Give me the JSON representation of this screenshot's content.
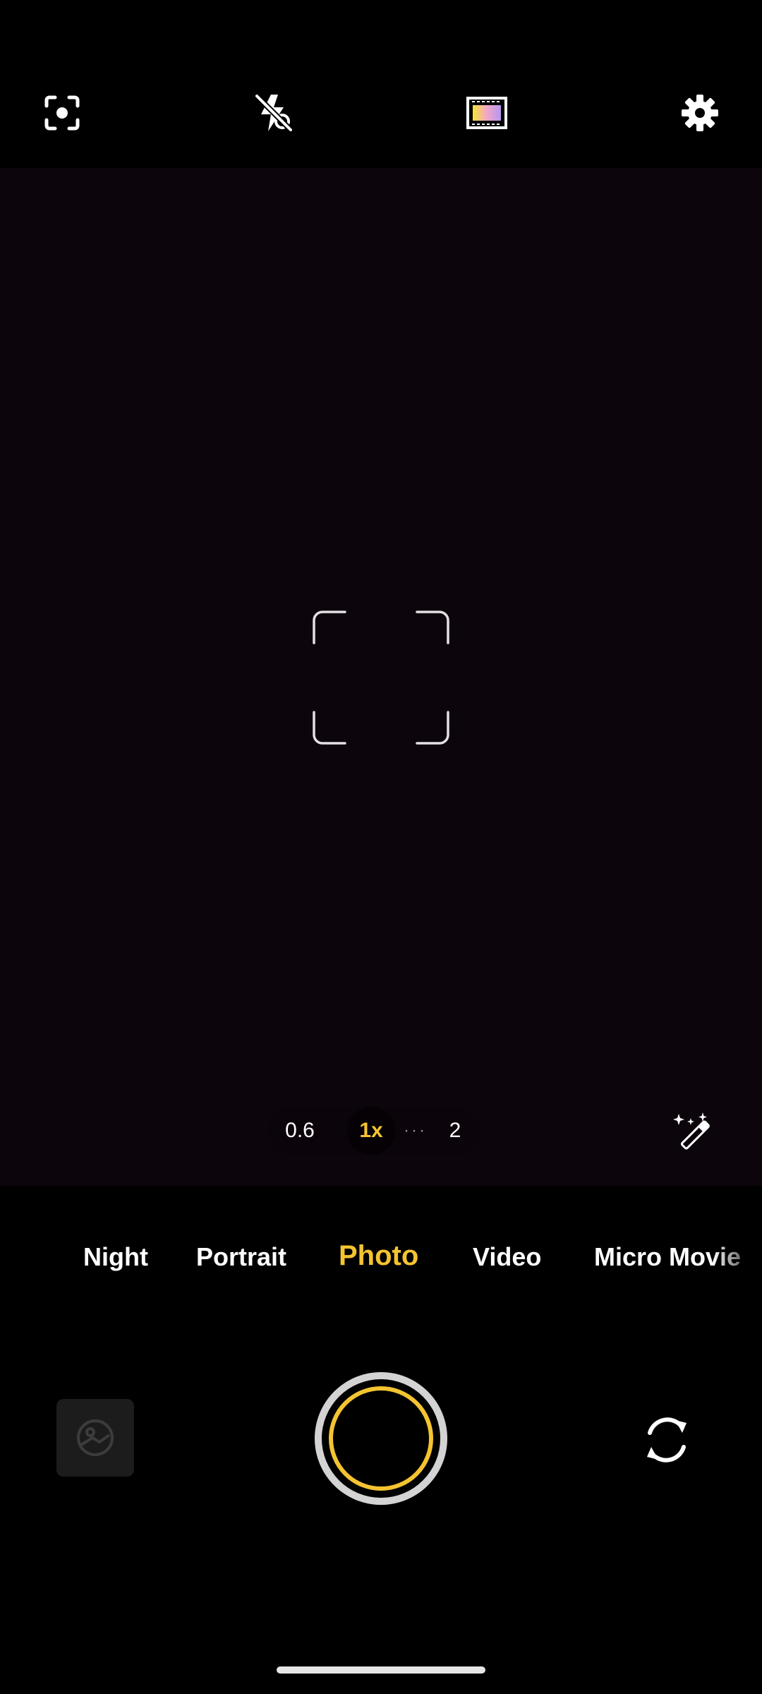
{
  "top_bar": {
    "icons": [
      "focus-scan-icon",
      "flash-off-icon",
      "filter-icon",
      "gear-icon"
    ]
  },
  "zoom": {
    "options": [
      "0.6",
      "1x",
      "2"
    ],
    "selected": "1x",
    "dots": "···"
  },
  "modes": {
    "items": [
      "Night",
      "Portrait",
      "Photo",
      "Video",
      "Micro Movie"
    ],
    "selected": "Photo"
  },
  "colors": {
    "accent": "#f4c430",
    "viewfinder_bg": "#0d050c",
    "bar_bg": "#000000"
  },
  "bottom_controls": {
    "icons": [
      "gallery-icon",
      "shutter-button",
      "switch-camera-icon"
    ]
  }
}
